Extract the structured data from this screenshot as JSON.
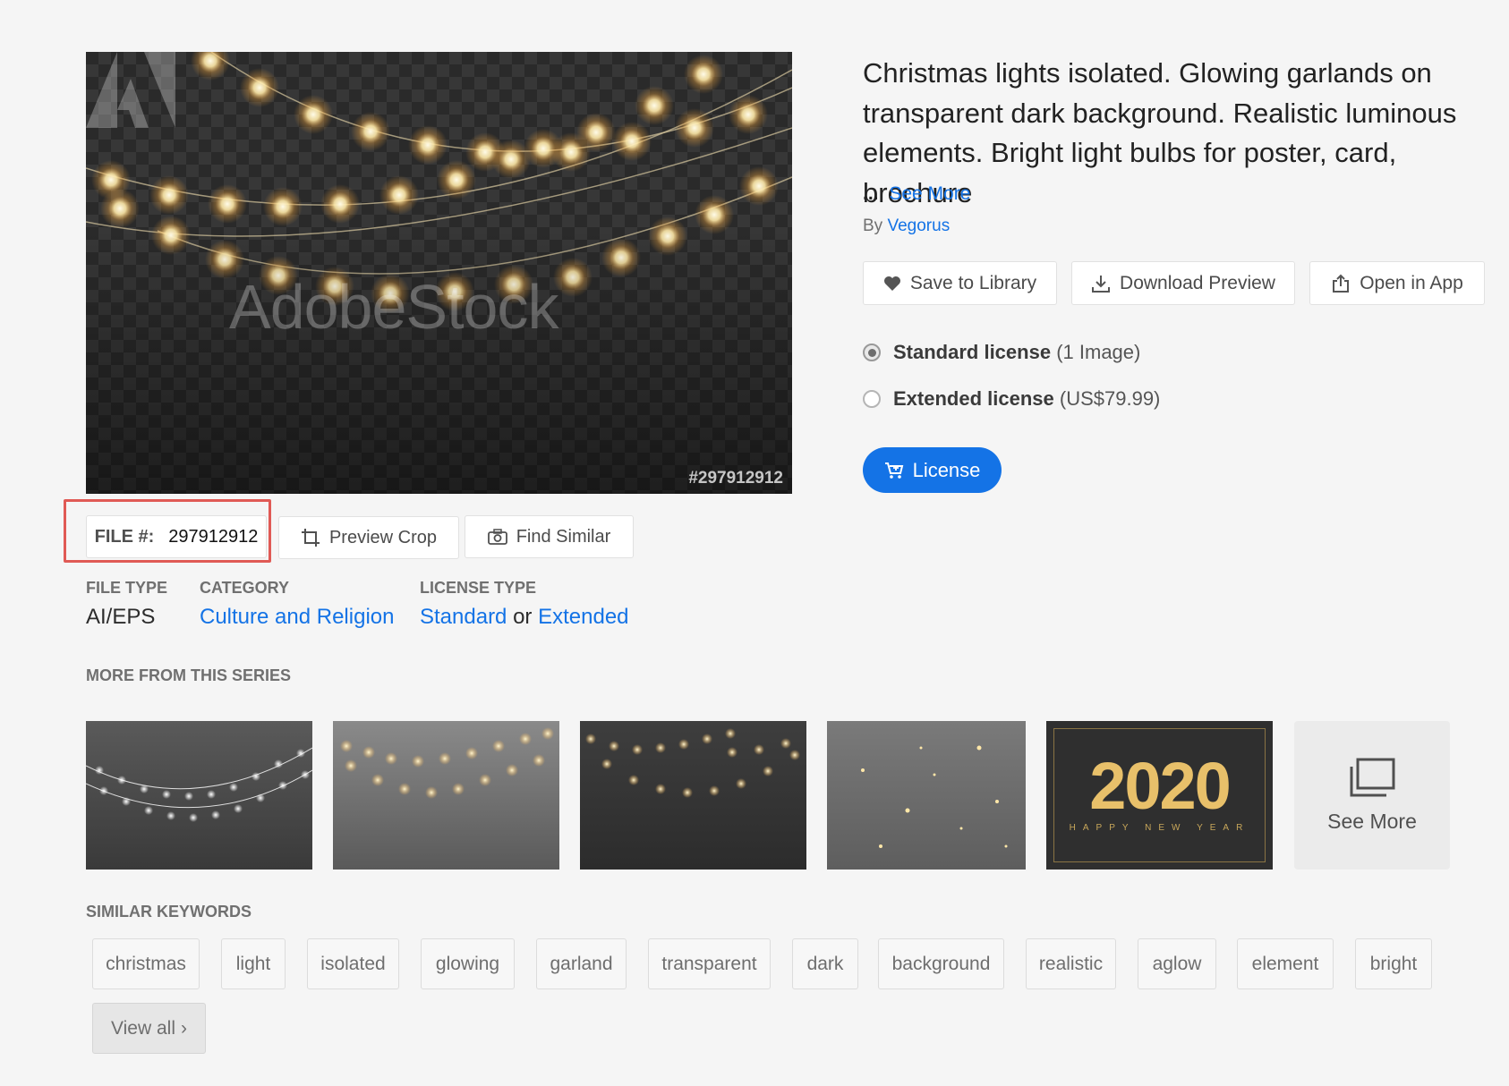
{
  "asset": {
    "title": "Christmas lights isolated. Glowing garlands on transparent dark background. Realistic luminous elements. Bright light bulbs for poster, card, brochure",
    "see_more_prefix": "...",
    "see_more_label": "See More",
    "by_label": "By",
    "author": "Vegorus",
    "watermark": "AdobeStock",
    "file_number_overlay": "#297912912"
  },
  "actions": {
    "save": "Save to Library",
    "download": "Download Preview",
    "open": "Open in App"
  },
  "licenses": {
    "standard_label": "Standard license",
    "standard_detail": "(1 Image)",
    "extended_label": "Extended license",
    "extended_detail": "(US$79.99)",
    "license_button": "License"
  },
  "file_bar": {
    "file_label": "FILE #:",
    "file_number": "297912912",
    "preview_crop": "Preview Crop",
    "find_similar": "Find Similar"
  },
  "meta": {
    "file_type_label": "FILE TYPE",
    "file_type_value": "AI/EPS",
    "category_label": "CATEGORY",
    "category_value": "Culture and Religion",
    "license_type_label": "LICENSE TYPE",
    "license_standard": "Standard",
    "license_or": "or",
    "license_extended": "Extended"
  },
  "series": {
    "heading": "MORE FROM THIS SERIES",
    "thumb5_big": "2020",
    "thumb5_small": "HAPPY NEW YEAR",
    "see_more": "See More"
  },
  "keywords": {
    "heading": "SIMILAR KEYWORDS",
    "items": [
      "christmas",
      "light",
      "isolated",
      "glowing",
      "garland",
      "transparent",
      "dark",
      "background",
      "realistic",
      "aglow",
      "element",
      "bright"
    ],
    "view_all": "View all"
  },
  "colors": {
    "accent": "#1473e6",
    "highlight": "#e05a55"
  }
}
